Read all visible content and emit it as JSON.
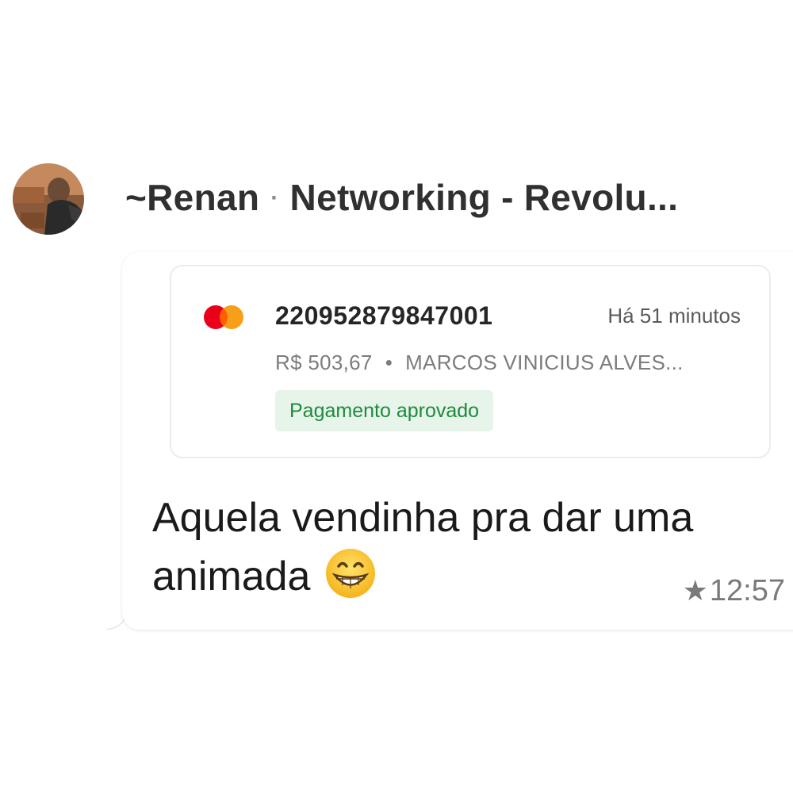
{
  "chat": {
    "sender_name": "~Renan",
    "separator": "·",
    "group_name": "Networking - Revolu..."
  },
  "card": {
    "icon": "mastercard-icon",
    "order_number": "220952879847001",
    "time_ago": "Há 51 minutos",
    "amount": "R$  503,67",
    "meta_separator": "•",
    "customer": "MARCOS VINICIUS ALVES...",
    "status": "Pagamento aprovado",
    "colors": {
      "status_text": "#1e8a3c",
      "status_bg": "#e6f4ea",
      "mc_red": "#eb001b",
      "mc_orange": "#f79e1b"
    }
  },
  "message": {
    "text_line1": "Aquela vendinha pra dar uma",
    "text_line2": "animada",
    "emoji": "grinning-face-icon",
    "star": "★",
    "timestamp": "12:57"
  }
}
